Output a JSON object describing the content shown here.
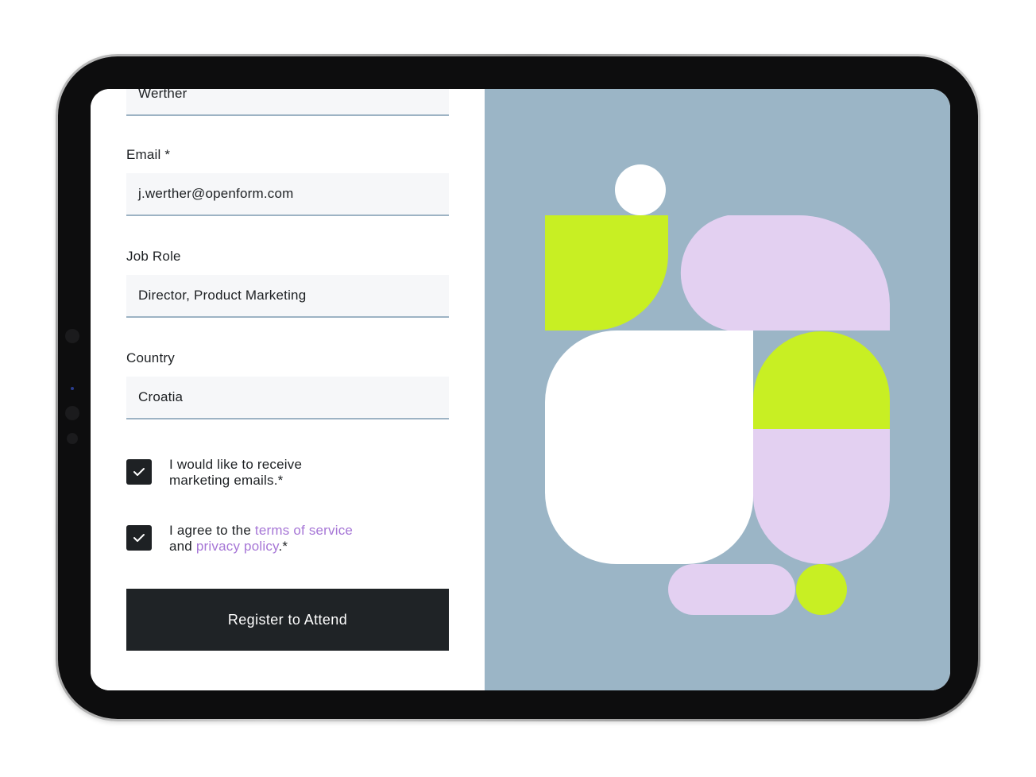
{
  "form": {
    "first_field_value": "Werther",
    "email": {
      "label": "Email *",
      "value": "j.werther@openform.com"
    },
    "job_role": {
      "label": "Job Role",
      "value": "Director, Product Marketing"
    },
    "country": {
      "label": "Country",
      "value": "Croatia"
    },
    "marketing_consent": {
      "line1": "I would like to receive",
      "line2": "marketing emails.*",
      "checked": true
    },
    "terms_consent": {
      "prefix": "I agree to the ",
      "terms_link": "terms of service",
      "and_text": "and ",
      "privacy_link": "privacy policy",
      "suffix": ".*",
      "checked": true
    },
    "submit_label": "Register to Attend"
  },
  "icons": {
    "checkbox_mark": "check-icon"
  },
  "colors": {
    "art_background": "#9bb5c6",
    "lime": "#c8ef23",
    "lilac": "#e3d0f1",
    "white": "#ffffff",
    "link": "#a676d6",
    "button": "#1f2326"
  }
}
